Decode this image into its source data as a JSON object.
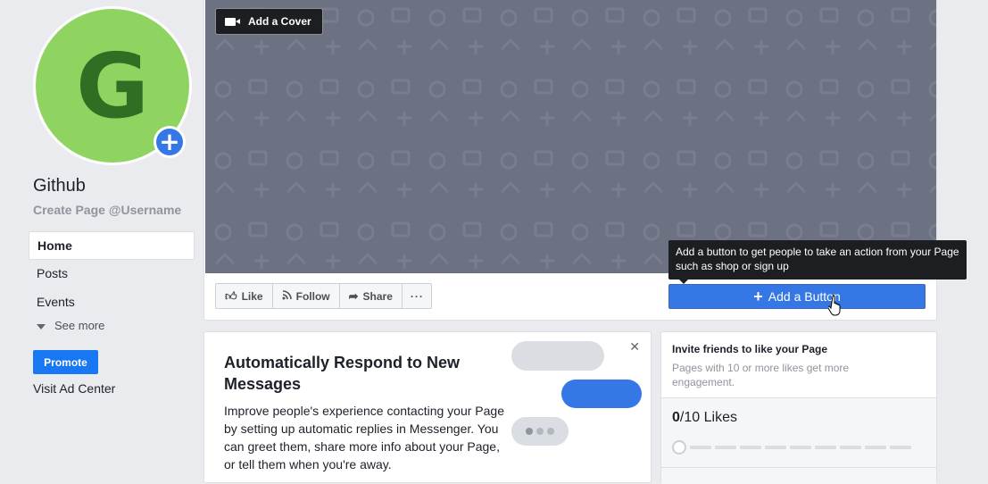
{
  "profile": {
    "avatar_letter": "G",
    "avatar_color": "#8fd460",
    "add_icon": "plus-circle-icon",
    "page_name": "Github",
    "username_cta": "Create Page @Username"
  },
  "sidebar": {
    "items": [
      {
        "label": "Home",
        "active": true
      },
      {
        "label": "Posts",
        "active": false
      },
      {
        "label": "Events",
        "active": false
      }
    ],
    "see_more": "See more",
    "promote_label": "Promote",
    "visit_ad_center": "Visit Ad Center"
  },
  "cover": {
    "add_cover_label": "Add a Cover",
    "add_cover_icon": "video-camera-icon",
    "background_color": "#6d7283"
  },
  "actions": {
    "like": "Like",
    "follow": "Follow",
    "share": "Share",
    "more_icon": "ellipsis-icon"
  },
  "cta": {
    "add_button_label": "Add a Button",
    "tooltip": "Add a button to get people to take an action from your Page such as shop or sign up",
    "accent_color": "#3578e5"
  },
  "auto_respond": {
    "title": "Automatically Respond to New Messages",
    "body": "Improve people's experience contacting your Page by setting up automatic replies in Messenger. You can greet them, share more info about your Page, or tell them when you're away.",
    "close_icon": "close-icon"
  },
  "invite": {
    "title": "Invite friends to like your Page",
    "subtitle": "Pages with 10 or more likes get more engagement.",
    "likes_current": "0",
    "likes_goal": "/10",
    "likes_label": "Likes",
    "progress_fraction": 0
  }
}
